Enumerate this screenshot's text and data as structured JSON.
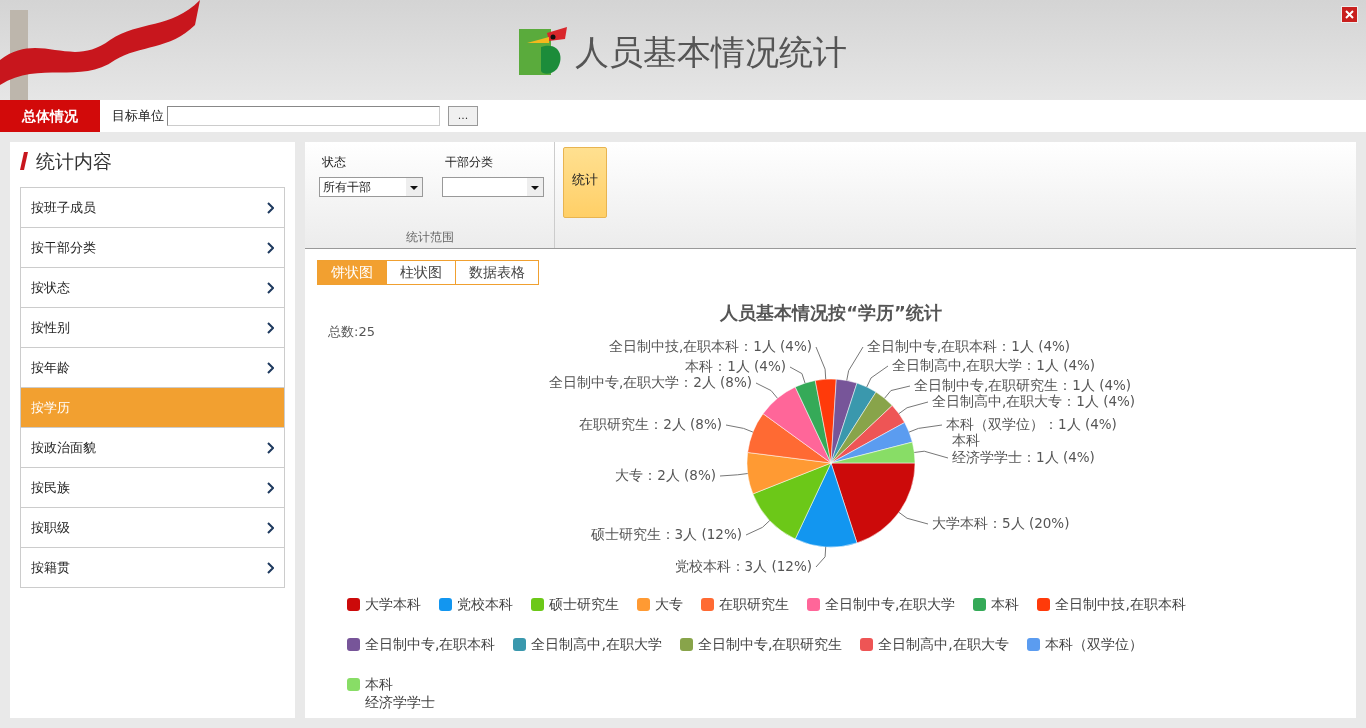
{
  "header": {
    "title": "人员基本情况统计"
  },
  "top_bar": {
    "tabs": [
      {
        "label": "总体情况",
        "selected": true
      }
    ],
    "target_unit": {
      "label": "目标单位"
    },
    "browse_button": "..."
  },
  "sidebar": {
    "heading": "统计内容",
    "items": [
      {
        "label": "按班子成员",
        "selected": false
      },
      {
        "label": "按干部分类",
        "selected": false
      },
      {
        "label": "按状态",
        "selected": false
      },
      {
        "label": "按性别",
        "selected": false
      },
      {
        "label": "按年龄",
        "selected": false
      },
      {
        "label": "按学历",
        "selected": true
      },
      {
        "label": "按政治面貌",
        "selected": false
      },
      {
        "label": "按民族",
        "selected": false
      },
      {
        "label": "按职级",
        "selected": false
      },
      {
        "label": "按籍贯",
        "selected": false
      }
    ]
  },
  "filters": {
    "status": {
      "label": "状态",
      "value": "所有干部"
    },
    "category": {
      "label": "干部分类"
    },
    "group_label": "统计范围",
    "run_button": "统计"
  },
  "view_tabs": [
    {
      "label": "饼状图",
      "selected": true
    },
    {
      "label": "柱状图",
      "selected": false
    },
    {
      "label": "数据表格",
      "selected": false
    }
  ],
  "total": "总数:25",
  "chart_data": {
    "type": "pie",
    "title": "人员基本情况按“学历”统计",
    "values": [
      5,
      3,
      3,
      2,
      2,
      2,
      1,
      1,
      1,
      1,
      1,
      1,
      1,
      1
    ],
    "value_labels": [
      "大学本科：5人 (20%)",
      "党校本科：3人 (12%)",
      "硕士研究生：3人 (12%)",
      "大专：2人 (8%)",
      "在职研究生：2人 (8%)",
      "全日制中专,在职大学：2人 (8%)",
      "本科：1人 (4%)",
      "全日制中技,在职本科：1人 (4%)",
      "全日制中专,在职本科：1人 (4%)",
      "全日制高中,在职大学：1人 (4%)",
      "全日制中专,在职研究生：1人 (4%)",
      "全日制高中,在职大专：1人 (4%)",
      "本科（双学位）：1人 (4%)",
      "本科经济学学士：1人 (4%)"
    ]
  },
  "legend": [
    {
      "label": "大学本科",
      "color": "#cc0a0a"
    },
    {
      "label": "党校本科",
      "color": "#1296f0"
    },
    {
      "label": "硕士研究生",
      "color": "#6cc818"
    },
    {
      "label": "大专",
      "color": "#ff9a33"
    },
    {
      "label": "在职研究生",
      "color": "#ff6a33"
    },
    {
      "label": "全日制中专,在职大学",
      "color": "#ff6699"
    },
    {
      "label": "本科",
      "color": "#35aa58"
    },
    {
      "label": "全日制中技,在职本科",
      "color": "#ff3a0a"
    },
    {
      "label": "全日制中专,在职本科",
      "color": "#775599"
    },
    {
      "label": "全日制高中,在职大学",
      "color": "#3a98ad"
    },
    {
      "label": "全日制中专,在职研究生",
      "color": "#88a44a"
    },
    {
      "label": "全日制高中,在职大专",
      "color": "#ee5555"
    },
    {
      "label": "本科（双学位）",
      "color": "#5b9cf0"
    },
    {
      "label": "本科经济学学士",
      "color": "#88dd66"
    }
  ]
}
